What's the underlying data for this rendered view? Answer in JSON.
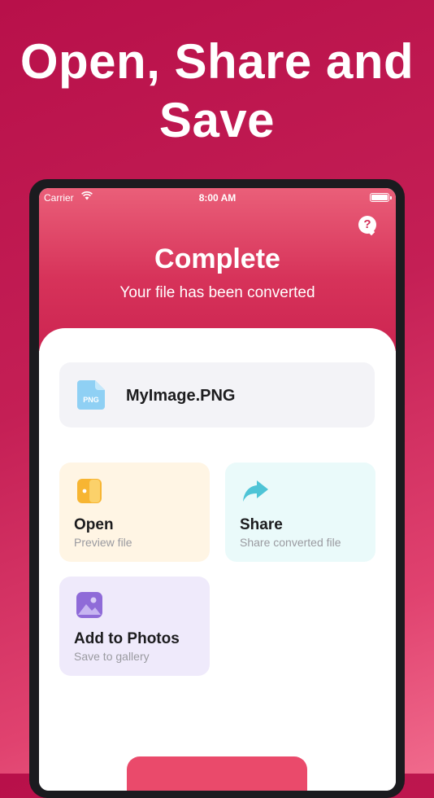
{
  "headline": {
    "line1": "Open, Share and",
    "line2": "Save"
  },
  "status_bar": {
    "carrier": "Carrier",
    "time": "8:00 AM"
  },
  "header": {
    "title": "Complete",
    "subtitle": "Your file has been converted",
    "help_icon": "question-bubble-icon"
  },
  "file": {
    "name": "MyImage.PNG",
    "icon_label": "PNG"
  },
  "actions": [
    {
      "label": "Open",
      "sub": "Preview file",
      "icon": "open-door-icon",
      "color": "#fff5e4"
    },
    {
      "label": "Share",
      "sub": "Share converted file",
      "icon": "share-arrow-icon",
      "color": "#eafafa"
    },
    {
      "label": "Add to Photos",
      "sub": "Save to gallery",
      "icon": "photo-icon",
      "color": "#efeafb"
    }
  ],
  "colors": {
    "accent": "#d7335a",
    "background": "#c41f55"
  }
}
